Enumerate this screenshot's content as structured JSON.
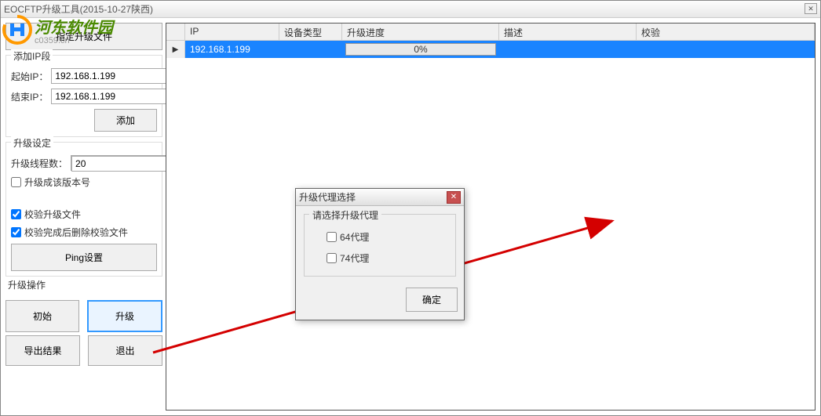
{
  "window": {
    "title": "EOCFTP升级工具(2015-10-27陕西)"
  },
  "watermark": {
    "cn": "河东软件园",
    "url": "c0359.cn"
  },
  "left": {
    "select_file_btn": "指定升级文件",
    "ip_section": {
      "title": "添加IP段",
      "start_label": "起始IP：",
      "start_value": "192.168.1.199",
      "end_label": "结束IP：",
      "end_value": "192.168.1.199",
      "add_btn": "添加"
    },
    "settings": {
      "title": "升级设定",
      "threads_label": "升级线程数：",
      "threads_value": "20",
      "cb_version_label": "升级成该版本号",
      "cb_verify_label": "校验升级文件",
      "cb_delete_label": "校验完成后删除校验文件",
      "ping_btn": "Ping设置"
    },
    "operation": {
      "title": "升级操作",
      "init_btn": "初始",
      "upgrade_btn": "升级",
      "export_btn": "导出结果",
      "exit_btn": "退出"
    }
  },
  "grid": {
    "headers": {
      "ip": "IP",
      "type": "设备类型",
      "progress": "升级进度",
      "desc": "描述",
      "check": "校验"
    },
    "rows": [
      {
        "ip": "192.168.1.199",
        "type": "",
        "progress": "0%",
        "desc": "",
        "check": ""
      }
    ]
  },
  "dialog": {
    "title": "升级代理选择",
    "group_title": "请选择升级代理",
    "opt64": "64代理",
    "opt74": "74代理",
    "ok_btn": "确定"
  }
}
